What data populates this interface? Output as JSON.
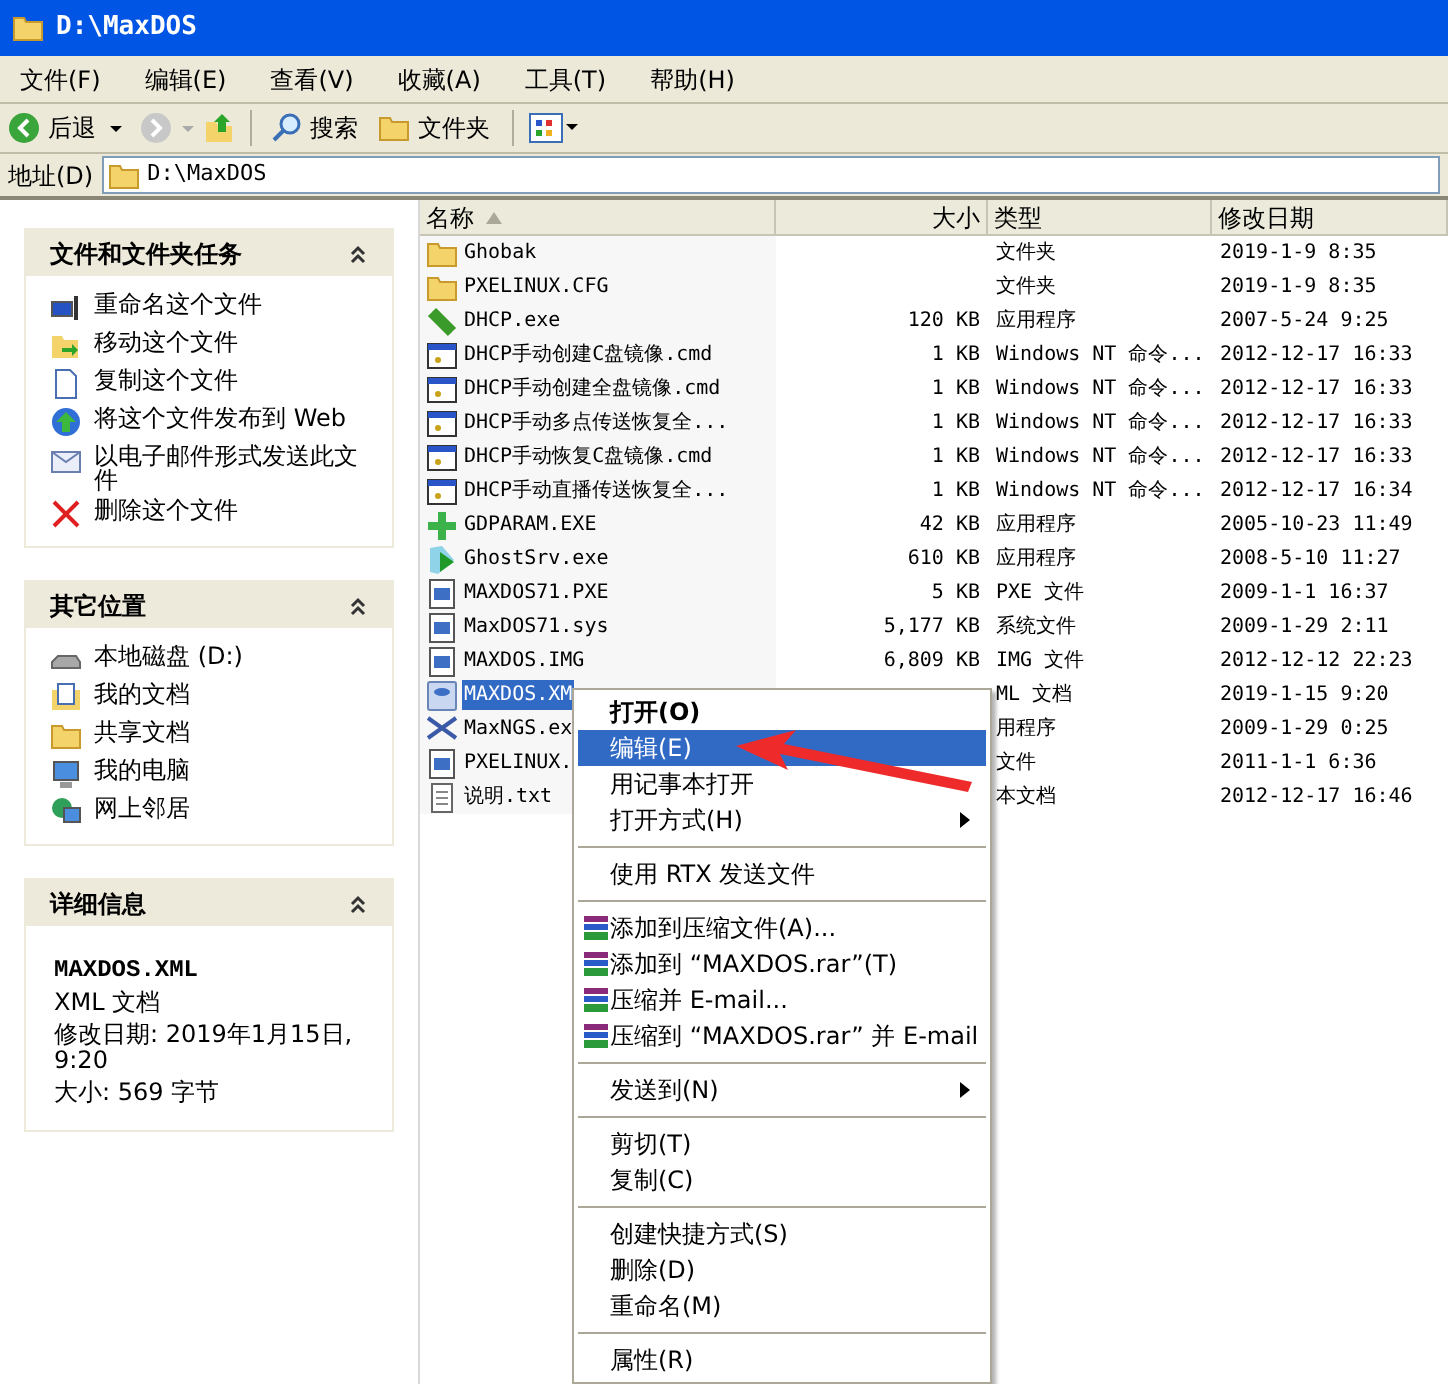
{
  "window": {
    "title": "D:\\MaxDOS"
  },
  "menu_bar": [
    "文件(F)",
    "编辑(E)",
    "查看(V)",
    "收藏(A)",
    "工具(T)",
    "帮助(H)"
  ],
  "toolbar": {
    "back": "后退",
    "search": "搜索",
    "folders": "文件夹"
  },
  "address_bar": {
    "label": "地址(D)",
    "value": "D:\\MaxDOS"
  },
  "sidebar": {
    "panels": [
      {
        "title": "文件和文件夹任务",
        "kind": "links",
        "items": [
          {
            "label": "重命名这个文件",
            "kind": "rename"
          },
          {
            "label": "移动这个文件",
            "kind": "move"
          },
          {
            "label": "复制这个文件",
            "kind": "copy"
          },
          {
            "label": "将这个文件发布到 Web",
            "kind": "web"
          },
          {
            "label": "以电子邮件形式发送此文件",
            "kind": "mail"
          },
          {
            "label": "删除这个文件",
            "kind": "delete"
          }
        ]
      },
      {
        "title": "其它位置",
        "kind": "links",
        "items": [
          {
            "label": "本地磁盘 (D:)",
            "kind": "disk"
          },
          {
            "label": "我的文档",
            "kind": "docs"
          },
          {
            "label": "共享文档",
            "kind": "folder"
          },
          {
            "label": "我的电脑",
            "kind": "computer"
          },
          {
            "label": "网上邻居",
            "kind": "network"
          }
        ]
      },
      {
        "title": "详细信息",
        "kind": "details",
        "name": "MAXDOS.XML",
        "type": "XML 文档",
        "modified": "修改日期: 2019年1月15日, 9:20",
        "size": "大小: 569 字节"
      }
    ]
  },
  "file_list": {
    "columns": [
      {
        "label": "名称",
        "sorted": true
      },
      {
        "label": "大小",
        "sorted": false
      },
      {
        "label": "类型",
        "sorted": false
      },
      {
        "label": "修改日期",
        "sorted": false
      }
    ],
    "rows": [
      {
        "name": "Ghobak",
        "type": "文件夹",
        "modified": "2019-1-9 8:35",
        "kind": "folder",
        "selected": false
      },
      {
        "name": "PXELINUX.CFG",
        "type": "文件夹",
        "modified": "2019-1-9 8:35",
        "kind": "folder",
        "selected": false
      },
      {
        "name": "DHCP.exe",
        "size": "120 KB",
        "type": "应用程序",
        "modified": "2007-5-24 9:25",
        "kind": "app",
        "selected": false
      },
      {
        "name": "DHCP手动创建C盘镜像.cmd",
        "size": "1 KB",
        "type": "Windows NT 命令...",
        "modified": "2012-12-17 16:33",
        "kind": "cmd",
        "selected": false
      },
      {
        "name": "DHCP手动创建全盘镜像.cmd",
        "size": "1 KB",
        "type": "Windows NT 命令...",
        "modified": "2012-12-17 16:33",
        "kind": "cmd",
        "selected": false
      },
      {
        "name": "DHCP手动多点传送恢复全...",
        "size": "1 KB",
        "type": "Windows NT 命令...",
        "modified": "2012-12-17 16:33",
        "kind": "cmd",
        "selected": false
      },
      {
        "name": "DHCP手动恢复C盘镜像.cmd",
        "size": "1 KB",
        "type": "Windows NT 命令...",
        "modified": "2012-12-17 16:33",
        "kind": "cmd",
        "selected": false
      },
      {
        "name": "DHCP手动直播传送恢复全...",
        "size": "1 KB",
        "type": "Windows NT 命令...",
        "modified": "2012-12-17 16:34",
        "kind": "cmd",
        "selected": false
      },
      {
        "name": "GDPARAM.EXE",
        "size": "42 KB",
        "type": "应用程序",
        "modified": "2005-10-23 11:49",
        "kind": "plus",
        "selected": false
      },
      {
        "name": "GhostSrv.exe",
        "size": "610 KB",
        "type": "应用程序",
        "modified": "2008-5-10 11:27",
        "kind": "play",
        "selected": false
      },
      {
        "name": "MAXDOS71.PXE",
        "size": "5 KB",
        "type": "PXE 文件",
        "modified": "2009-1-1 16:37",
        "kind": "generic",
        "selected": false
      },
      {
        "name": "MaxDOS71.sys",
        "size": "5,177 KB",
        "type": "系统文件",
        "modified": "2009-1-29 2:11",
        "kind": "generic",
        "selected": false
      },
      {
        "name": "MAXDOS.IMG",
        "size": "6,809 KB",
        "type": "IMG 文件",
        "modified": "2012-12-12 22:23",
        "kind": "generic",
        "selected": false
      },
      {
        "name": "MAXDOS.XM",
        "type": "ML 文档",
        "modified": "2019-1-15 9:20",
        "kind": "xml",
        "selected": true
      },
      {
        "name": "MaxNGS.ex",
        "type": "用程序",
        "modified": "2009-1-29 0:25",
        "kind": "ngs",
        "selected": false
      },
      {
        "name": "PXELINUX.",
        "type": "文件",
        "modified": "2011-1-1 6:36",
        "kind": "generic",
        "selected": false
      },
      {
        "name": "说明.txt",
        "type": "本文档",
        "modified": "2012-12-17 16:46",
        "kind": "txt",
        "selected": false
      }
    ]
  },
  "context_menu": [
    {
      "kind": "item",
      "label": "打开(O)",
      "default": true,
      "selected": false
    },
    {
      "kind": "item",
      "label": "编辑(E)",
      "default": false,
      "selected": true
    },
    {
      "kind": "item",
      "label": "用记事本打开",
      "default": false,
      "selected": false
    },
    {
      "kind": "submenu",
      "label": "打开方式(H)",
      "default": false,
      "selected": false
    },
    {
      "kind": "separator"
    },
    {
      "kind": "item",
      "label": "使用 RTX 发送文件",
      "default": false,
      "selected": false
    },
    {
      "kind": "separator"
    },
    {
      "kind": "archive",
      "label": "添加到压缩文件(A)...",
      "default": false,
      "selected": false
    },
    {
      "kind": "archive",
      "label": "添加到 “MAXDOS.rar”(T)",
      "default": false,
      "selected": false
    },
    {
      "kind": "archive",
      "label": "压缩并 E-mail...",
      "default": false,
      "selected": false
    },
    {
      "kind": "archive",
      "label": "压缩到 “MAXDOS.rar” 并 E-mail",
      "default": false,
      "selected": false
    },
    {
      "kind": "separator"
    },
    {
      "kind": "submenu",
      "label": "发送到(N)",
      "default": false,
      "selected": false
    },
    {
      "kind": "separator"
    },
    {
      "kind": "item",
      "label": "剪切(T)",
      "default": false,
      "selected": false
    },
    {
      "kind": "item",
      "label": "复制(C)",
      "default": false,
      "selected": false
    },
    {
      "kind": "separator"
    },
    {
      "kind": "item",
      "label": "创建快捷方式(S)",
      "default": false,
      "selected": false
    },
    {
      "kind": "item",
      "label": "删除(D)",
      "default": false,
      "selected": false
    },
    {
      "kind": "item",
      "label": "重命名(M)",
      "default": false,
      "selected": false
    },
    {
      "kind": "separator"
    },
    {
      "kind": "item",
      "label": "属性(R)",
      "default": false,
      "selected": false
    }
  ]
}
